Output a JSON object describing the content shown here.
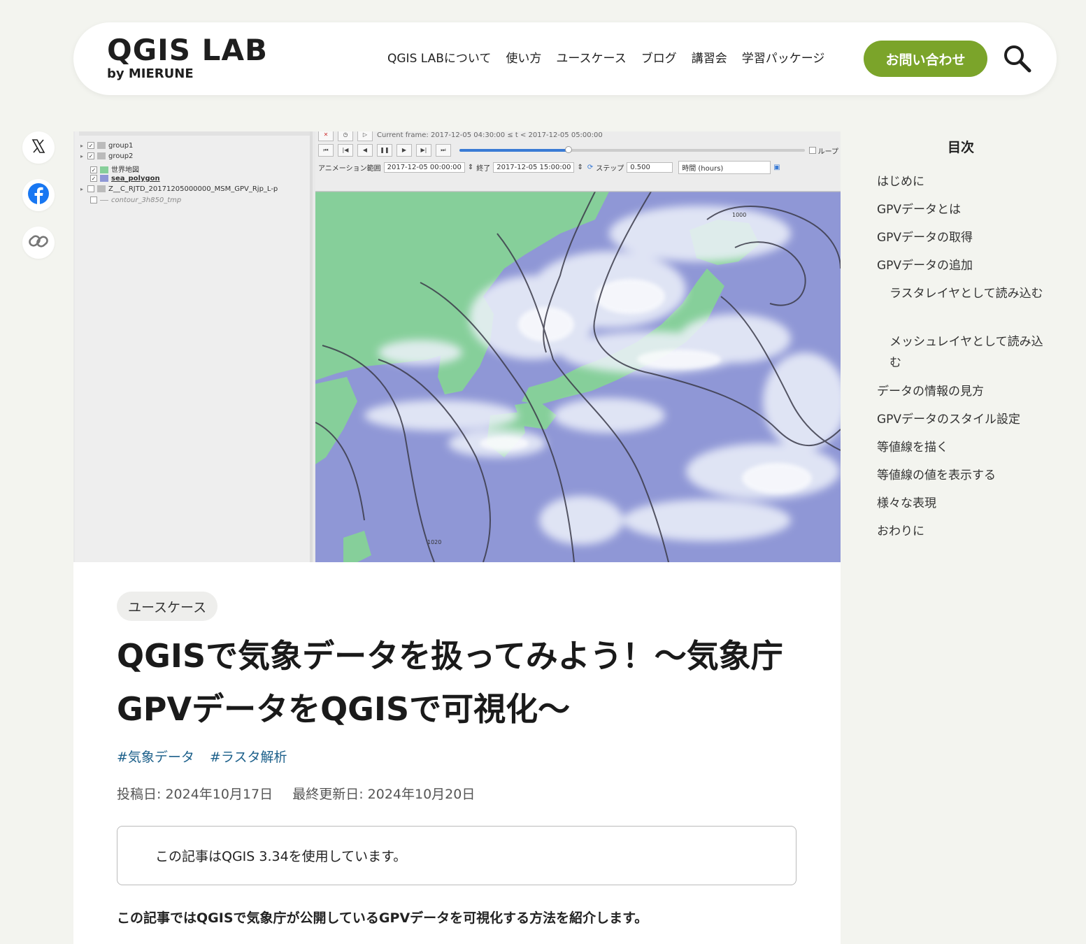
{
  "header": {
    "logo_main": "QGIS LAB",
    "logo_sub": "by MIERUNE",
    "nav": [
      "QGIS LABについて",
      "使い方",
      "ユースケース",
      "ブログ",
      "講習会",
      "学習パッケージ"
    ],
    "contact_label": "お問い合わせ"
  },
  "hero": {
    "layers": [
      "group1",
      "group2",
      "世界地図",
      "sea_polygon",
      "Z__C_RJTD_20171205000000_MSM_GPV_Rjp_L-p",
      "contour_3h850_tmp"
    ],
    "current_frame": "Current frame: 2017-12-05 04:30:00 ≤ t < 2017-12-05 05:00:00",
    "loop_label": "ループ",
    "range_label": "アニメーション範囲",
    "range_start": "2017-12-05 00:00:00",
    "end_label": "終了",
    "range_end": "2017-12-05 15:00:00",
    "step_label": "ステップ",
    "step_value": "0.500",
    "step_unit": "時間 (hours)",
    "contour_labels": [
      "1000",
      "1020"
    ]
  },
  "article": {
    "category": "ユースケース",
    "title": "QGISで気象データを扱ってみよう！〜気象庁GPVデータをQGISで可視化〜",
    "tags": [
      "#気象データ",
      "#ラスタ解析"
    ],
    "posted": "投稿日: 2024年10月17日",
    "updated": "最終更新日: 2024年10月20日",
    "notice": "この記事はQGIS 3.34を使用しています。",
    "lead": "この記事ではQGISで気象庁が公開しているGPVデータを可視化する方法を紹介します。"
  },
  "toc": {
    "title": "目次",
    "items": [
      "はじめに",
      "GPVデータとは",
      "GPVデータの取得",
      "GPVデータの追加",
      "ラスタレイヤとして読み込む",
      "メッシュレイヤとして読み込む",
      "データの情報の見方",
      "GPVデータのスタイル設定",
      "等値線を描く",
      "等値線の値を表示する",
      "様々な表現",
      "おわりに"
    ]
  },
  "share": [
    "x-icon",
    "facebook-icon",
    "link-icon"
  ],
  "colors": {
    "accent": "#7ba42a",
    "tag": "#1b5f8a",
    "sea": "#8f97d6",
    "land": "#86cf9a",
    "cloud": "#e6ecf6"
  }
}
